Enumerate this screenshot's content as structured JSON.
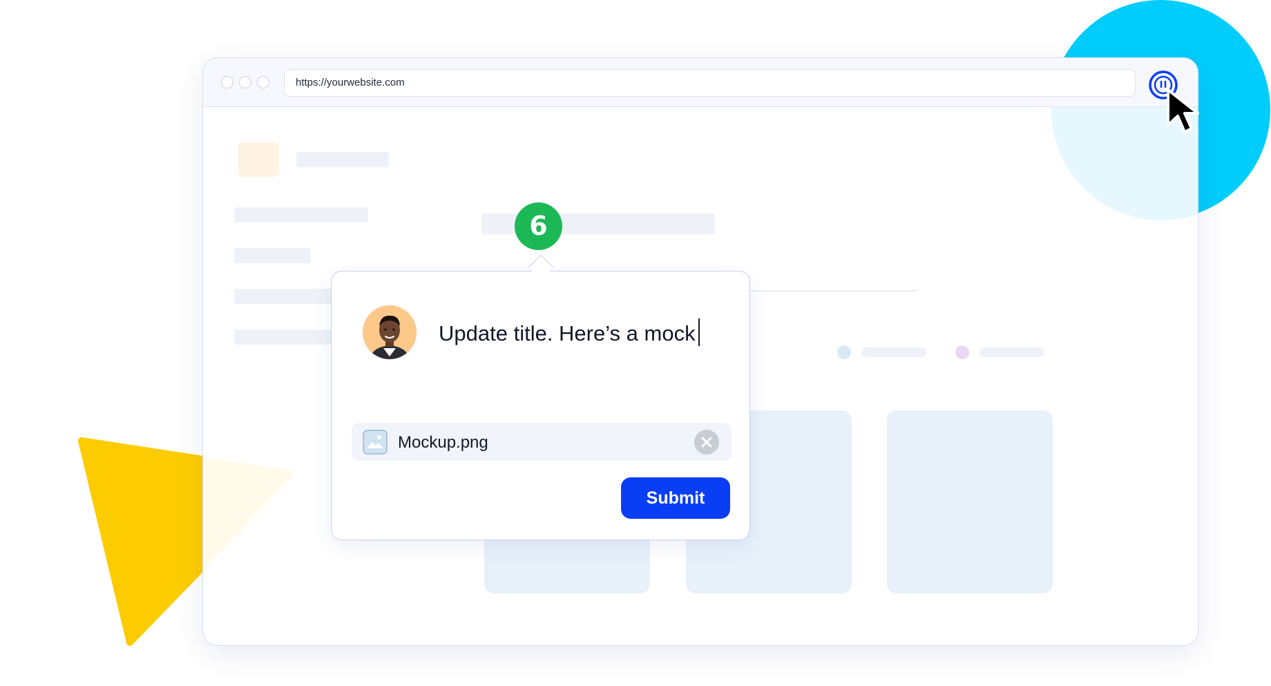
{
  "browser": {
    "url": "https://yourwebsite.com",
    "extension_icon": "feedback-extension-icon"
  },
  "step": {
    "number": "6",
    "color": "#1db856"
  },
  "comment": {
    "text": "Update title. Here’s a mock",
    "attachment": {
      "file_name": "Mockup.png",
      "icon": "image-file-icon"
    },
    "submit_label": "Submit"
  },
  "colors": {
    "accent": "#0a3ef5",
    "circle": "#00cdfc",
    "triangle": "#fccc00"
  }
}
